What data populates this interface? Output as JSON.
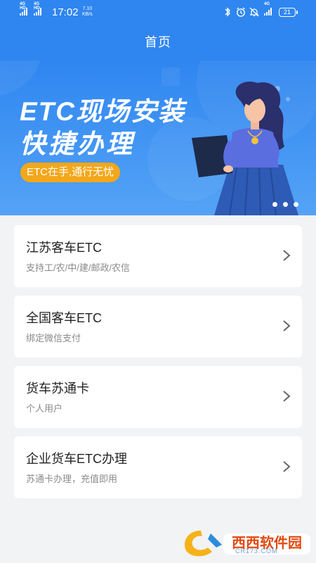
{
  "status_bar": {
    "time": "17:02",
    "speed_value": "7.10",
    "speed_unit": "KB/s",
    "network_1": "4G HD",
    "network_2": "4G HD",
    "network_3": "4G",
    "battery": "21",
    "icons": [
      "bluetooth-icon",
      "alarm-icon",
      "mute-icon",
      "signal-icon",
      "battery-icon"
    ]
  },
  "header": {
    "title": "首页"
  },
  "banner": {
    "line1": "ETC现场安装",
    "line2": "快捷办理",
    "tag": "ETC在手,通行无忧",
    "pages": 3,
    "active_page": 1
  },
  "cards": [
    {
      "title": "江苏客车ETC",
      "subtitle": "支持工/农/中/建/邮政/农信"
    },
    {
      "title": "全国客车ETC",
      "subtitle": "绑定微信支付"
    },
    {
      "title": "货车苏通卡",
      "subtitle": "个人用户"
    },
    {
      "title": "企业货车ETC办理",
      "subtitle": "苏通卡办理，充值即用"
    }
  ],
  "watermark": {
    "text": "西西软件园",
    "small": "CR173.COM"
  },
  "colors": {
    "primary": "#2f86f0",
    "accent": "#f3a71a",
    "background": "#f2f3f5"
  }
}
